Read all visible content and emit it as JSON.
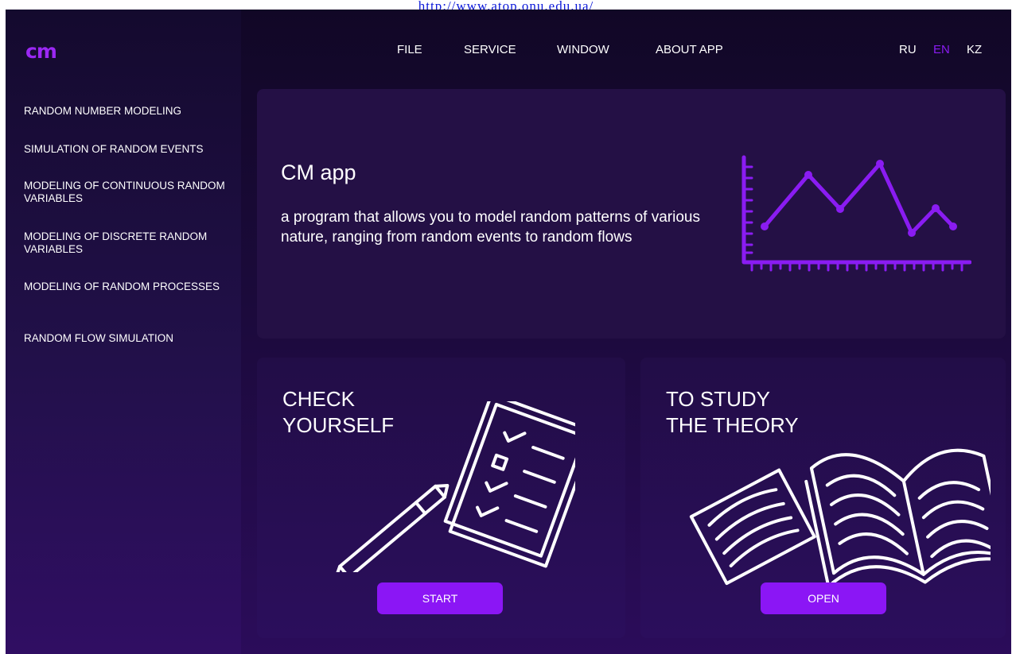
{
  "top_link": {
    "text": "http://www.atop.onu.edu.ua/"
  },
  "app": {
    "logo": "cm"
  },
  "menu": {
    "items": [
      {
        "label": "FILE"
      },
      {
        "label": "SERVICE"
      },
      {
        "label": "WINDOW"
      },
      {
        "label": "ABOUT APP"
      }
    ]
  },
  "languages": {
    "items": [
      {
        "label": "RU"
      },
      {
        "label": "EN",
        "active": true
      },
      {
        "label": "KZ"
      }
    ]
  },
  "sidebar": {
    "items": [
      {
        "label": "RANDOM NUMBER MODELING"
      },
      {
        "label": "SIMULATION OF RANDOM EVENTS"
      },
      {
        "label": "MODELING OF CONTINUOUS RANDOM VARIABLES"
      },
      {
        "label": "MODELING OF DISCRETE RANDOM VARIABLES"
      },
      {
        "label": "MODELING OF RANDOM PROCESSES"
      },
      {
        "label": "RANDOM FLOW SIMULATION"
      }
    ]
  },
  "hero": {
    "title": "CM app",
    "description": "a program that allows you to model random patterns of various nature, ranging from random events to random flows",
    "chart_icon": "line-chart-icon"
  },
  "cards": {
    "check": {
      "title": "CHECK\nYOURSELF",
      "button": "START",
      "icon": "checklist-pencil-icon"
    },
    "theory": {
      "title": "TO STUDY\nTHE THEORY",
      "button": "OPEN",
      "icon": "open-book-icon"
    }
  },
  "colors": {
    "accent": "#8b16f5",
    "logo": "#9b28f4",
    "active_language": "#8a1cf2",
    "background_dark": "#110726",
    "card": "#241045",
    "text": "#ffffff",
    "link": "#0b18d8"
  }
}
